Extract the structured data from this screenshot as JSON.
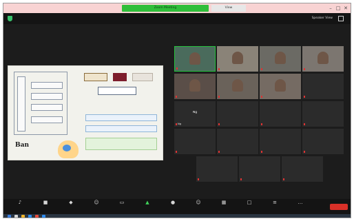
{
  "titlebar": {
    "meeting_title": "Zoom Meeting",
    "view_label": "View",
    "colors": {
      "bar": "#f8d3d3",
      "meeting_tab": "#2fbf3a"
    }
  },
  "topbar": {
    "speaker_view_label": "Speaker View"
  },
  "slide": {
    "left_vertical_label": "",
    "left_items": [
      "",
      "",
      "",
      ""
    ],
    "title_box": "",
    "subtitle": "",
    "boxes": [
      "",
      "",
      ""
    ],
    "logo_text": "Ban"
  },
  "participants": [
    {
      "name": "",
      "type": "video",
      "active": true
    },
    {
      "name": "",
      "type": "video"
    },
    {
      "name": "",
      "type": "video"
    },
    {
      "name": "",
      "type": "video"
    },
    {
      "name": "",
      "type": "video"
    },
    {
      "name": "",
      "type": "video"
    },
    {
      "name": "",
      "type": "video"
    },
    {
      "name": "",
      "type": "name"
    },
    {
      "name": "Ng",
      "type": "name"
    },
    {
      "name": "",
      "type": "name"
    },
    {
      "name": "",
      "type": "name"
    },
    {
      "name": "",
      "type": "name"
    },
    {
      "name": "",
      "type": "name"
    },
    {
      "name": "",
      "type": "name"
    },
    {
      "name": "",
      "type": "name"
    },
    {
      "name": "",
      "type": "name"
    },
    {
      "name": "",
      "type": "name"
    },
    {
      "name": "",
      "type": "name"
    },
    {
      "name": "",
      "type": "name"
    }
  ],
  "toolbar": {
    "items": [
      {
        "label": "",
        "icon": "microphone-icon"
      },
      {
        "label": "",
        "icon": "camera-icon"
      },
      {
        "label": "",
        "icon": "shield-icon"
      },
      {
        "label": "",
        "icon": "participants-icon"
      },
      {
        "label": "",
        "icon": "chat-icon"
      },
      {
        "label": "",
        "icon": "share-screen-icon",
        "highlight": true
      },
      {
        "label": "",
        "icon": "record-icon"
      },
      {
        "label": "",
        "icon": "reactions-icon"
      },
      {
        "label": "",
        "icon": "apps-icon"
      },
      {
        "label": "",
        "icon": "whiteboard-icon"
      },
      {
        "label": "",
        "icon": "notes-icon"
      },
      {
        "label": "",
        "icon": "more-icon"
      }
    ],
    "end_label": ""
  },
  "taskbar": {
    "tray_text": ""
  }
}
